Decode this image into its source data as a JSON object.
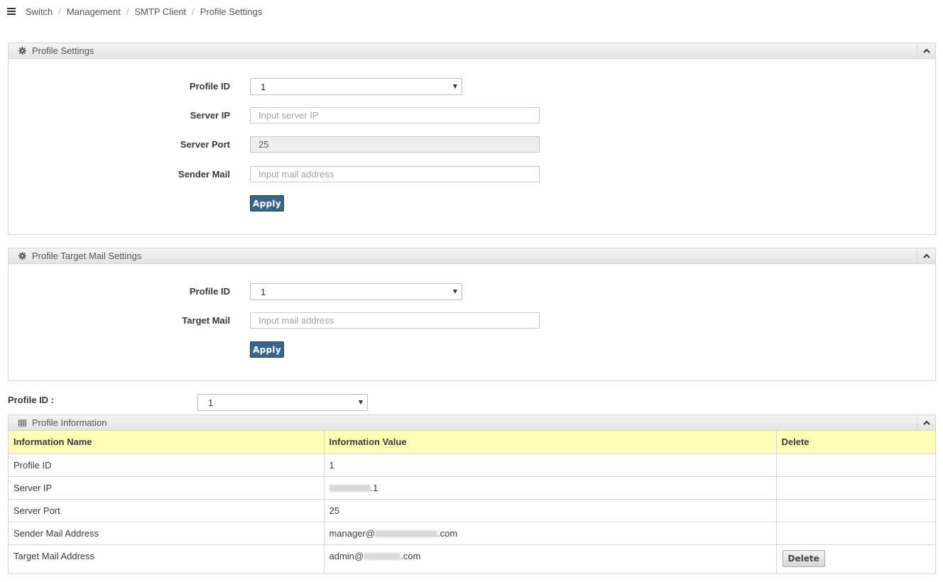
{
  "breadcrumb": [
    "Switch",
    "Management",
    "SMTP Client",
    "Profile Settings"
  ],
  "profile_settings": {
    "title": "Profile Settings",
    "profile_id_label": "Profile ID",
    "profile_id_value": "1",
    "server_ip_label": "Server IP",
    "server_ip_placeholder": "Input server IP",
    "server_port_label": "Server Port",
    "server_port_value": "25",
    "sender_mail_label": "Sender Mail",
    "sender_mail_placeholder": "Input mail address",
    "apply_label": "Apply"
  },
  "target_settings": {
    "title": "Profile Target Mail Settings",
    "profile_id_label": "Profile ID",
    "profile_id_value": "1",
    "target_mail_label": "Target Mail",
    "target_mail_placeholder": "Input mail address",
    "apply_label": "Apply"
  },
  "profile_filter": {
    "label": "Profile ID :",
    "value": "1"
  },
  "profile_info": {
    "title": "Profile Information",
    "columns": [
      "Information Name",
      "Information Value",
      "Delete"
    ],
    "rows": [
      {
        "name": "Profile ID",
        "value": "1"
      },
      {
        "name": "Server IP",
        "value_suffix": ".1"
      },
      {
        "name": "Server Port",
        "value": "25"
      },
      {
        "name": "Sender Mail Address",
        "value_prefix": "manager@",
        "value_suffix": ".com"
      },
      {
        "name": "Target Mail Address",
        "value_prefix": "admin@",
        "value_suffix": ".com"
      }
    ],
    "delete_label": "Delete"
  },
  "icons": {
    "menu": "hamburger-icon",
    "gear": "gear-icon",
    "table": "table-icon",
    "collapse": "chevron-up-icon"
  },
  "colors": {
    "apply_button": "#3b6584",
    "table_header": "#ffffb8",
    "panel_header": "#e8e8e8"
  }
}
